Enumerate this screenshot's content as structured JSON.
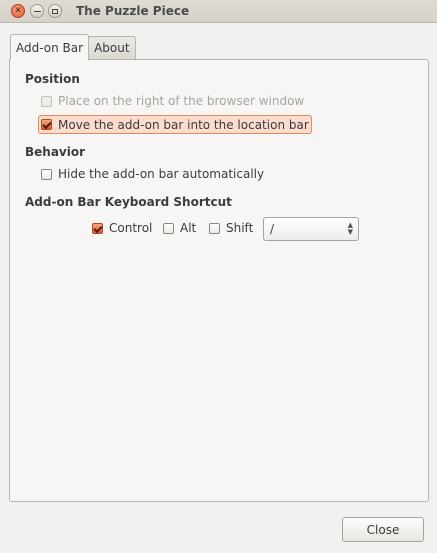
{
  "window": {
    "title": "The Puzzle Piece"
  },
  "tabs": [
    {
      "label": "Add-on Bar",
      "active": true
    },
    {
      "label": "About",
      "active": false
    }
  ],
  "position": {
    "heading": "Position",
    "right_of_window": {
      "label": "Place on the right of the browser window",
      "checked": false,
      "enabled": false
    },
    "into_location_bar": {
      "label": "Move the add-on bar into the location bar",
      "checked": true,
      "enabled": true
    }
  },
  "behavior": {
    "heading": "Behavior",
    "hide_auto": {
      "label": "Hide the add-on bar automatically",
      "checked": false
    }
  },
  "shortcut": {
    "heading": "Add-on Bar Keyboard Shortcut",
    "control": {
      "label": "Control",
      "checked": true
    },
    "alt": {
      "label": "Alt",
      "checked": false
    },
    "shift": {
      "label": "Shift",
      "checked": false
    },
    "key_value": "/"
  },
  "footer": {
    "close_label": "Close"
  },
  "colors": {
    "accent": "#dd5c2d",
    "focus_bg": "#fbdccd"
  }
}
